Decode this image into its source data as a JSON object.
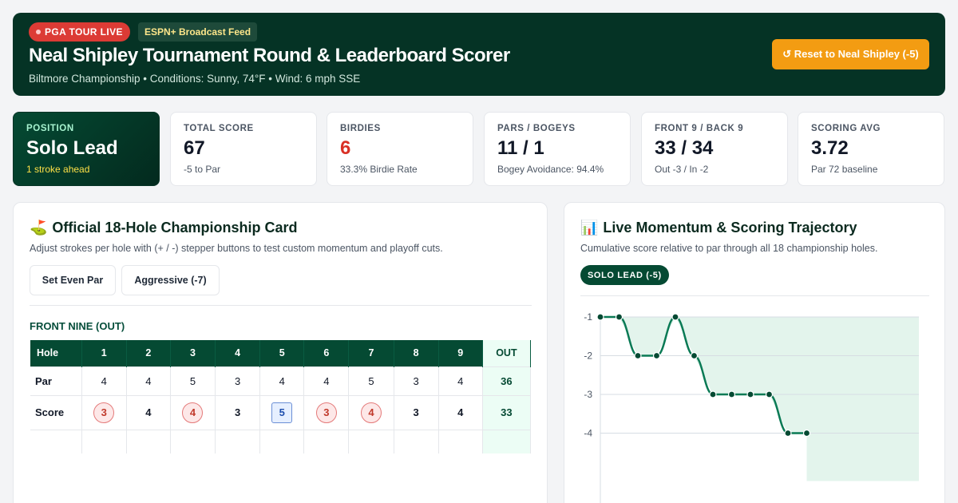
{
  "header": {
    "live_label": "PGA TOUR LIVE",
    "feed_label": "ESPN+ Broadcast Feed",
    "title": "Neal Shipley Tournament Round & Leaderboard Scorer",
    "subtitle": "Biltmore Championship  •  Conditions: Sunny, 74°F • Wind: 6 mph SSE",
    "reset_label": "↺ Reset to Neal Shipley (-5)"
  },
  "stats": [
    {
      "label": "POSITION",
      "value": "Solo Lead",
      "sub": "1 stroke ahead"
    },
    {
      "label": "TOTAL SCORE",
      "value": "67",
      "sub": "-5 to Par"
    },
    {
      "label": "BIRDIES",
      "value": "6",
      "sub": "33.3% Birdie Rate"
    },
    {
      "label": "PARS / BOGEYS",
      "value": "11 / 1",
      "sub": "Bogey Avoidance: 94.4%"
    },
    {
      "label": "FRONT 9 / BACK 9",
      "value": "33 / 34",
      "sub": "Out -3 / In -2"
    },
    {
      "label": "SCORING AVG",
      "value": "3.72",
      "sub": "Par 72 baseline"
    }
  ],
  "scorecard": {
    "icon": "golf-flag-icon",
    "title": "Official 18-Hole Championship Card",
    "desc": "Adjust strokes per hole with (+ / -) stepper buttons to test custom momentum and playoff cuts.",
    "btn_even": "Set Even Par",
    "btn_aggr": "Aggressive (-7)",
    "front_label": "FRONT NINE (OUT)",
    "head_hole": "Hole",
    "head_out": "OUT",
    "holes": [
      "1",
      "2",
      "3",
      "4",
      "5",
      "6",
      "7",
      "8",
      "9"
    ],
    "par_label": "Par",
    "par": [
      "4",
      "4",
      "5",
      "3",
      "4",
      "4",
      "5",
      "3",
      "4"
    ],
    "par_out": "36",
    "score_label": "Score",
    "score": [
      "3",
      "4",
      "4",
      "3",
      "5",
      "3",
      "4",
      "3",
      "4"
    ],
    "score_out": "33"
  },
  "momentum": {
    "icon": "bar-chart-icon",
    "title": "Live Momentum & Scoring Trajectory",
    "desc": "Cumulative score relative to par through all 18 championship holes.",
    "badge": "SOLO LEAD (-5)"
  },
  "colors": {
    "header_bg": "#053325",
    "accent_green": "#054a33",
    "live_red": "#dc3b35",
    "reset_orange": "#f39c12",
    "birdie_red": "#d93025",
    "line_green": "#0a7a55"
  },
  "chart_data": {
    "type": "line",
    "title": "",
    "xlabel": "",
    "ylabel": "",
    "x": [
      1,
      2,
      3,
      4,
      5,
      6,
      7,
      8,
      9,
      10,
      11,
      12
    ],
    "series": [
      {
        "values": [
          -1,
          -1,
          -2,
          -2,
          -1,
          -2,
          -3,
          -3,
          -3,
          -3,
          -4,
          -4
        ]
      }
    ],
    "y_ticks": [
      "-1",
      "-2",
      "-3",
      "-4"
    ],
    "ylim": [
      -4,
      -1
    ],
    "grid": true,
    "area_fill": true
  }
}
